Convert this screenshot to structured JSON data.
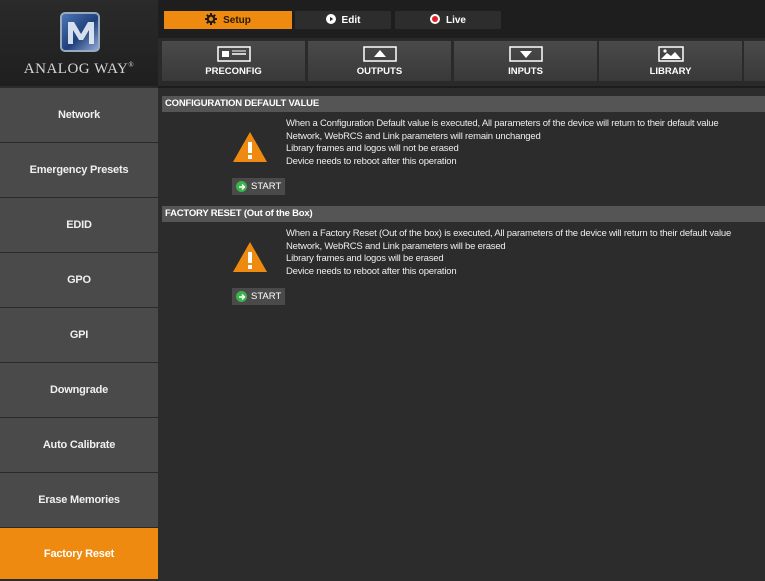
{
  "brand": {
    "logo_text": "ANALOG WAY",
    "logo_reg": "®"
  },
  "modes": [
    {
      "label": "Setup",
      "icon": "gear-icon"
    },
    {
      "label": "Edit",
      "icon": "play-icon"
    },
    {
      "label": "Live",
      "icon": "record-icon"
    }
  ],
  "tabs": [
    {
      "label": "PRECONFIG",
      "icon": "preconfig-icon"
    },
    {
      "label": "OUTPUTS",
      "icon": "outputs-icon"
    },
    {
      "label": "INPUTS",
      "icon": "inputs-icon"
    },
    {
      "label": "LIBRARY",
      "icon": "library-icon"
    }
  ],
  "sidebar": {
    "items": [
      {
        "label": "Network"
      },
      {
        "label": "Emergency Presets"
      },
      {
        "label": "EDID"
      },
      {
        "label": "GPO"
      },
      {
        "label": "GPI"
      },
      {
        "label": "Downgrade"
      },
      {
        "label": "Auto Calibrate"
      },
      {
        "label": "Erase Memories"
      },
      {
        "label": "Factory Reset"
      }
    ],
    "active_index": 8
  },
  "sections": [
    {
      "title": "CONFIGURATION DEFAULT VALUE",
      "lines": [
        "When a Configuration Default value is executed, All parameters of the device will return to their default value",
        "Network, WebRCS and Link parameters will remain unchanged",
        "Library frames and logos will not be erased",
        "Device needs to reboot after this operation"
      ],
      "button_label": "START"
    },
    {
      "title": "FACTORY RESET (Out of the Box)",
      "lines": [
        "When a Factory Reset (Out of the box) is executed, All parameters of the device will return to their default value",
        "Network, WebRCS and Link parameters will be erased",
        "Library frames and logos will be erased",
        "Device needs to reboot after this operation"
      ],
      "button_label": "START"
    }
  ],
  "colors": {
    "accent": "#ef8a10",
    "panel": "#4a4a4a",
    "warning": "#ef8a10",
    "go": "#3ab34a"
  }
}
